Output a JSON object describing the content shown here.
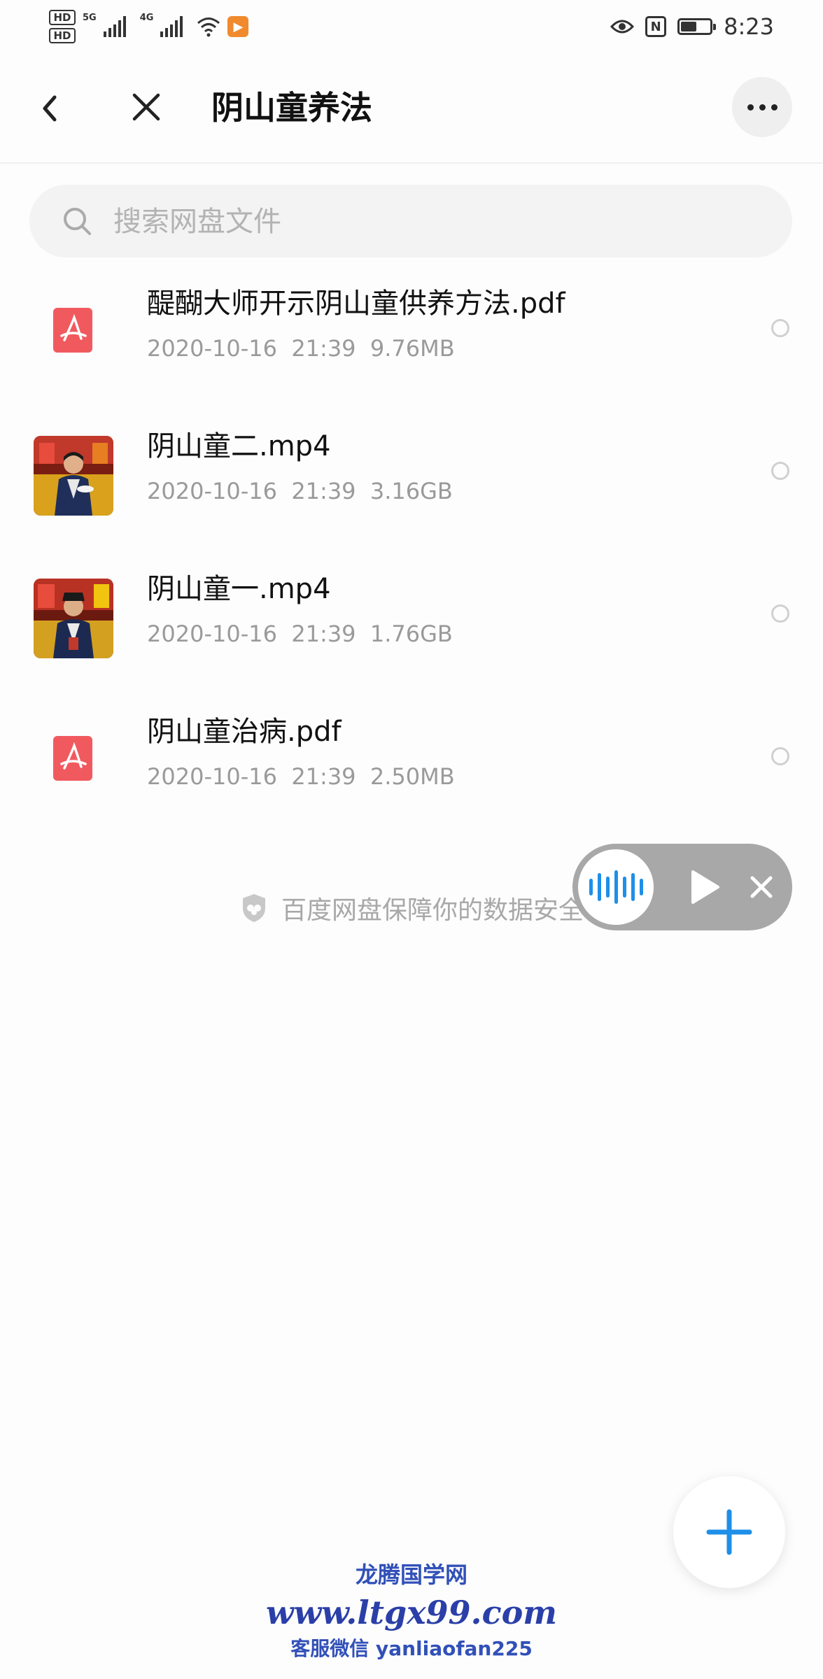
{
  "status_bar": {
    "hd1": "HD",
    "hd2": "HD",
    "net1": "5G",
    "net2": "4G",
    "time": "8:23"
  },
  "nav": {
    "title": "阴山童养法"
  },
  "search": {
    "placeholder": "搜索网盘文件"
  },
  "files": [
    {
      "name": "醍醐大师开示阴山童供养方法.pdf",
      "date": "2020-10-16  21:39",
      "size": "9.76MB",
      "type": "pdf"
    },
    {
      "name": "阴山童二.mp4",
      "date": "2020-10-16  21:39",
      "size": "3.16GB",
      "type": "video"
    },
    {
      "name": "阴山童一.mp4",
      "date": "2020-10-16  21:39",
      "size": "1.76GB",
      "type": "video"
    },
    {
      "name": "阴山童治病.pdf",
      "date": "2020-10-16  21:39",
      "size": "2.50MB",
      "type": "pdf"
    }
  ],
  "security_note": "百度网盘保障你的数据安全",
  "watermark": {
    "line1": "龙腾国学网",
    "line2": "www.ltgx99.com",
    "line3": "客服微信 yanliaofan225"
  },
  "colors": {
    "accent": "#1e8fe8",
    "pdf_red": "#f05a5f",
    "watermark_blue": "#2a3fa8"
  },
  "icons": [
    "back-icon",
    "close-icon",
    "more-icon",
    "search-icon",
    "pdf-icon",
    "shield-icon",
    "voice-wave-icon",
    "play-icon",
    "plus-icon"
  ]
}
